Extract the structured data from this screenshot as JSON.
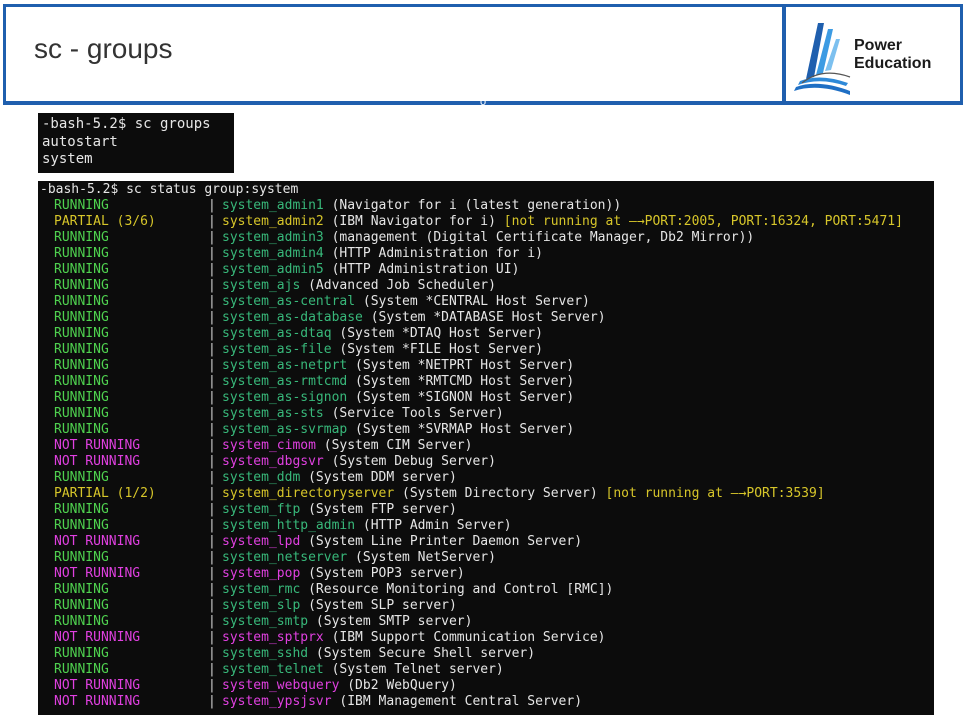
{
  "slide": {
    "title": "sc - groups",
    "logo": {
      "line1": "Power",
      "line2": "Education"
    },
    "mark": "o"
  },
  "colors": {
    "frame_blue": "#1f5fae",
    "running": "#4fd14f",
    "not_running": "#e040e0",
    "partial": "#d7c62a",
    "service_running": "#38b87a",
    "terminal_bg": "#0c0c0c"
  },
  "terminal1": {
    "lines": [
      "-bash-5.2$ sc groups",
      "autostart",
      "system"
    ]
  },
  "terminal2": {
    "command": "-bash-5.2$ sc status group:system",
    "separator": "|",
    "rows": [
      {
        "status": "RUNNING",
        "kind": "running",
        "service": "system_admin1",
        "desc": " (Navigator for i (latest generation))",
        "warn": ""
      },
      {
        "status": "PARTIAL (3/6)",
        "kind": "partial",
        "service": "system_admin2",
        "desc": " (IBM Navigator for i) ",
        "warn": "[not running at —→PORT:2005, PORT:16324, PORT:5471]"
      },
      {
        "status": "RUNNING",
        "kind": "running",
        "service": "system_admin3",
        "desc": " (management (Digital Certificate Manager, Db2 Mirror))",
        "warn": ""
      },
      {
        "status": "RUNNING",
        "kind": "running",
        "service": "system_admin4",
        "desc": " (HTTP Administration for i)",
        "warn": ""
      },
      {
        "status": "RUNNING",
        "kind": "running",
        "service": "system_admin5",
        "desc": " (HTTP Administration UI)",
        "warn": ""
      },
      {
        "status": "RUNNING",
        "kind": "running",
        "service": "system_ajs",
        "desc": " (Advanced Job Scheduler)",
        "warn": ""
      },
      {
        "status": "RUNNING",
        "kind": "running",
        "service": "system_as-central",
        "desc": " (System *CENTRAL Host Server)",
        "warn": ""
      },
      {
        "status": "RUNNING",
        "kind": "running",
        "service": "system_as-database",
        "desc": " (System *DATABASE Host Server)",
        "warn": ""
      },
      {
        "status": "RUNNING",
        "kind": "running",
        "service": "system_as-dtaq",
        "desc": " (System *DTAQ Host Server)",
        "warn": ""
      },
      {
        "status": "RUNNING",
        "kind": "running",
        "service": "system_as-file",
        "desc": " (System *FILE Host Server)",
        "warn": ""
      },
      {
        "status": "RUNNING",
        "kind": "running",
        "service": "system_as-netprt",
        "desc": " (System *NETPRT Host Server)",
        "warn": ""
      },
      {
        "status": "RUNNING",
        "kind": "running",
        "service": "system_as-rmtcmd",
        "desc": " (System *RMTCMD Host Server)",
        "warn": ""
      },
      {
        "status": "RUNNING",
        "kind": "running",
        "service": "system_as-signon",
        "desc": " (System *SIGNON Host Server)",
        "warn": ""
      },
      {
        "status": "RUNNING",
        "kind": "running",
        "service": "system_as-sts",
        "desc": " (Service Tools Server)",
        "warn": ""
      },
      {
        "status": "RUNNING",
        "kind": "running",
        "service": "system_as-svrmap",
        "desc": " (System *SVRMAP Host Server)",
        "warn": ""
      },
      {
        "status": "NOT RUNNING",
        "kind": "notrunning",
        "service": "system_cimom",
        "desc": " (System CIM Server)",
        "warn": ""
      },
      {
        "status": "NOT RUNNING",
        "kind": "notrunning",
        "service": "system_dbgsvr",
        "desc": " (System Debug Server)",
        "warn": ""
      },
      {
        "status": "RUNNING",
        "kind": "running",
        "service": "system_ddm",
        "desc": " (System DDM server)",
        "warn": ""
      },
      {
        "status": "PARTIAL (1/2)",
        "kind": "partial",
        "service": "system_directoryserver",
        "desc": " (System Directory Server) ",
        "warn": "[not running at —→PORT:3539]"
      },
      {
        "status": "RUNNING",
        "kind": "running",
        "service": "system_ftp",
        "desc": " (System FTP server)",
        "warn": ""
      },
      {
        "status": "RUNNING",
        "kind": "running",
        "service": "system_http_admin",
        "desc": " (HTTP Admin Server)",
        "warn": ""
      },
      {
        "status": "NOT RUNNING",
        "kind": "notrunning",
        "service": "system_lpd",
        "desc": " (System Line Printer Daemon Server)",
        "warn": ""
      },
      {
        "status": "RUNNING",
        "kind": "running",
        "service": "system_netserver",
        "desc": " (System NetServer)",
        "warn": ""
      },
      {
        "status": "NOT RUNNING",
        "kind": "notrunning",
        "service": "system_pop",
        "desc": " (System POP3 server)",
        "warn": ""
      },
      {
        "status": "RUNNING",
        "kind": "running",
        "service": "system_rmc",
        "desc": " (Resource Monitoring and Control [RMC])",
        "warn": ""
      },
      {
        "status": "RUNNING",
        "kind": "running",
        "service": "system_slp",
        "desc": " (System SLP server)",
        "warn": ""
      },
      {
        "status": "RUNNING",
        "kind": "running",
        "service": "system_smtp",
        "desc": " (System SMTP server)",
        "warn": ""
      },
      {
        "status": "NOT RUNNING",
        "kind": "notrunning",
        "service": "system_sptprx",
        "desc": " (IBM Support Communication Service)",
        "warn": ""
      },
      {
        "status": "RUNNING",
        "kind": "running",
        "service": "system_sshd",
        "desc": " (System Secure Shell server)",
        "warn": ""
      },
      {
        "status": "RUNNING",
        "kind": "running",
        "service": "system_telnet",
        "desc": " (System Telnet server)",
        "warn": ""
      },
      {
        "status": "NOT RUNNING",
        "kind": "notrunning",
        "service": "system_webquery",
        "desc": " (Db2 WebQuery)",
        "warn": ""
      },
      {
        "status": "NOT RUNNING",
        "kind": "notrunning",
        "service": "system_ypsjsvr",
        "desc": " (IBM Management Central Server)",
        "warn": ""
      }
    ]
  }
}
